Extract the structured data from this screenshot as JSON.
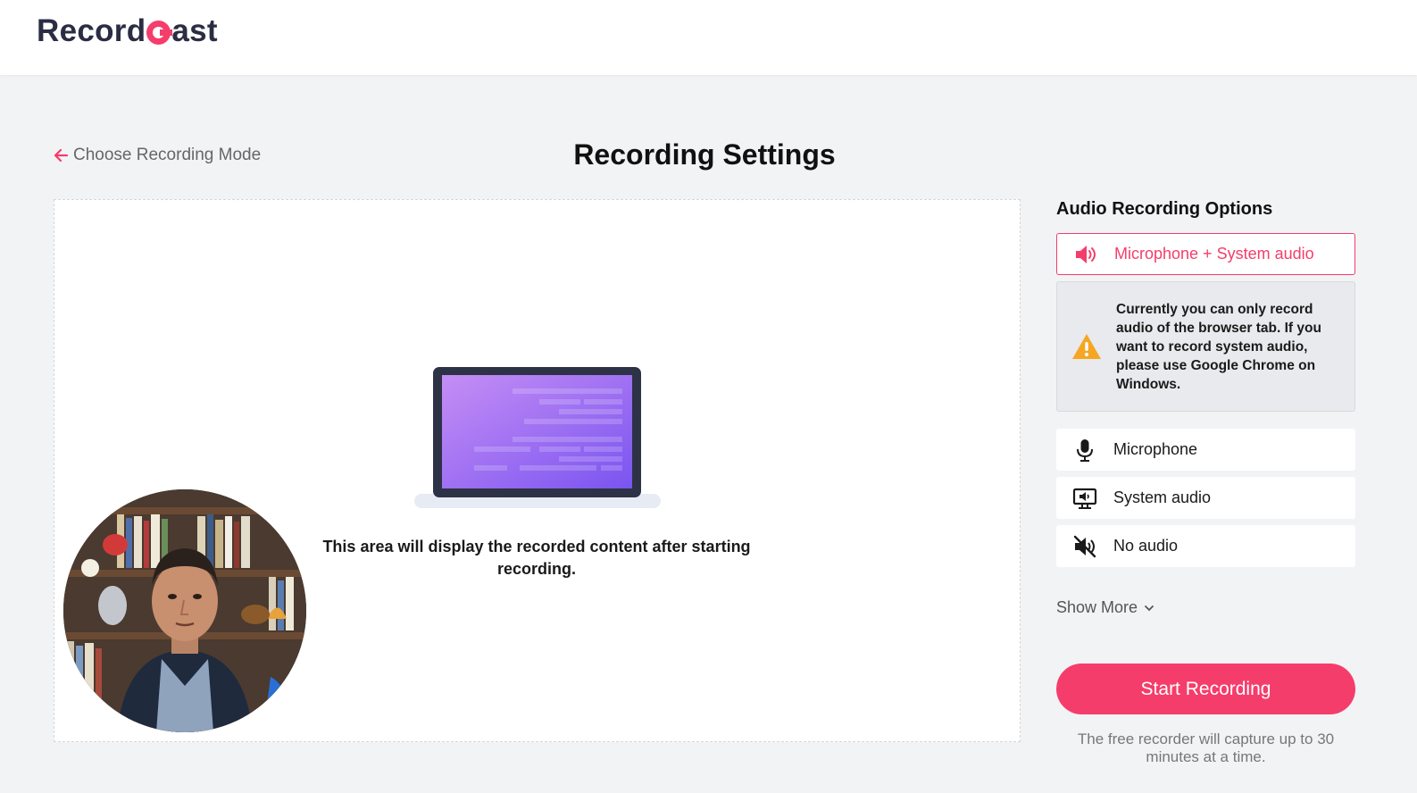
{
  "header": {
    "logo_part1": "Record",
    "logo_part2": "ast"
  },
  "nav": {
    "back_label": "Choose Recording Mode"
  },
  "page": {
    "title": "Recording Settings"
  },
  "preview": {
    "message": "This area will display the recorded content after starting recording."
  },
  "audio": {
    "heading": "Audio Recording Options",
    "selected": {
      "label": "Microphone + System audio",
      "icon": "speaker-icon"
    },
    "warning": {
      "icon": "warning-icon",
      "text": "Currently you can only record audio of the browser tab. If you want to record system audio, please use Google Chrome on Windows."
    },
    "options": [
      {
        "label": "Microphone",
        "icon": "microphone-icon"
      },
      {
        "label": "System audio",
        "icon": "monitor-speaker-icon"
      },
      {
        "label": "No audio",
        "icon": "mute-icon"
      }
    ],
    "show_more": "Show More"
  },
  "actions": {
    "start_label": "Start Recording",
    "note": "The free recorder will capture up to 30 minutes at a time."
  },
  "colors": {
    "accent": "#f53d6b",
    "warning": "#f5a623",
    "background": "#f2f3f5"
  }
}
